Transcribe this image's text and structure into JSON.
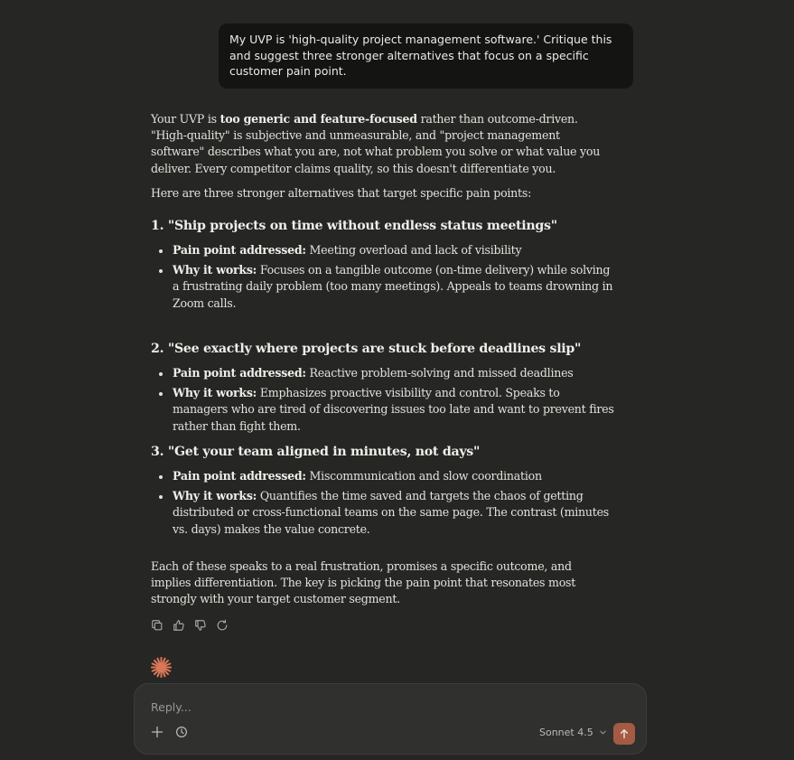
{
  "user_message": "My UVP is 'high-quality project management software.' Critique this and suggest three stronger alternatives that focus on a specific customer pain point.",
  "response": {
    "intro": {
      "before": "Your UVP is ",
      "bold": "too generic and feature-focused",
      "after": " rather than outcome-driven. \"High-quality\" is subjective and unmeasurable, and \"project management software\" describes what you are, not what problem you solve or what value you deliver. Every competitor claims quality, so this doesn't differentiate you."
    },
    "lead": "Here are three stronger alternatives that target specific pain points:",
    "alternatives": [
      {
        "heading": "1. \"Ship projects on time without endless status meetings\"",
        "pain_label": "Pain point addressed:",
        "pain_text": " Meeting overload and lack of visibility",
        "why_label": "Why it works:",
        "why_text": " Focuses on a tangible outcome (on-time delivery) while solving a frustrating daily problem (too many meetings). Appeals to teams drowning in Zoom calls."
      },
      {
        "heading": "2. \"See exactly where projects are stuck before deadlines slip\"",
        "pain_label": "Pain point addressed:",
        "pain_text": " Reactive problem-solving and missed deadlines",
        "why_label": "Why it works:",
        "why_text": " Emphasizes proactive visibility and control. Speaks to managers who are tired of discovering issues too late and want to prevent fires rather than fight them."
      },
      {
        "heading": "3. \"Get your team aligned in minutes, not days\"",
        "pain_label": "Pain point addressed:",
        "pain_text": " Miscommunication and slow coordination",
        "why_label": "Why it works:",
        "why_text": " Quantifies the time saved and targets the chaos of getting distributed or cross-functional teams on the same page. The contrast (minutes vs. days) makes the value concrete."
      }
    ],
    "conclusion": "Each of these speaks to a real frustration, promises a specific outcome, and implies differentiation. The key is picking the pain point that resonates most strongly with your target customer segment."
  },
  "actions": [
    "copy-icon",
    "thumbs-up-icon",
    "thumbs-down-icon",
    "retry-icon"
  ],
  "composer": {
    "placeholder": "Reply...",
    "model": "Sonnet 4.5",
    "icons": [
      "plus-icon",
      "clock-icon",
      "chevron-down-icon",
      "arrow-up-icon"
    ]
  },
  "colors": {
    "background": "#262624",
    "user_bubble": "#141413",
    "composer": "#30302e",
    "accent": "#a55a43",
    "burst": "#d97757"
  }
}
